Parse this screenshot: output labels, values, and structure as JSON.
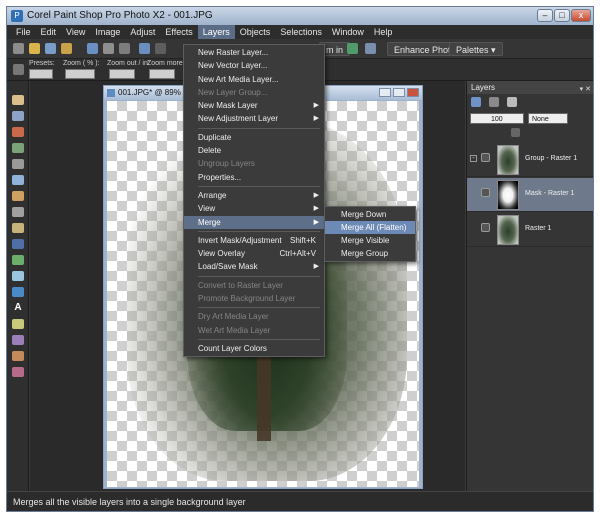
{
  "window": {
    "title": "Corel Paint Shop Pro Photo X2 - 001.JPG",
    "min": "–",
    "max": "□",
    "close": "x"
  },
  "menubar": [
    {
      "label": "File"
    },
    {
      "label": "Edit"
    },
    {
      "label": "View"
    },
    {
      "label": "Image"
    },
    {
      "label": "Adjust"
    },
    {
      "label": "Effects"
    },
    {
      "label": "Layers"
    },
    {
      "label": "Objects"
    },
    {
      "label": "Selections"
    },
    {
      "label": "Window"
    },
    {
      "label": "Help"
    }
  ],
  "toolbar": {
    "zoom_in": "m in",
    "enhance_photo": "Enhance Photo ▾",
    "palettes": "Palettes ▾"
  },
  "tool_options": {
    "presets": "Presets:",
    "zoom_pct": "Zoom ( % ):",
    "zoom_out_in": "Zoom out / in:",
    "zoom_more": "Zoom more:"
  },
  "image_window": {
    "title": "001.JPG* @  89%"
  },
  "layers_menu": [
    {
      "label": "New Raster Layer...",
      "state": "normal"
    },
    {
      "label": "New Vector Layer...",
      "state": "normal"
    },
    {
      "label": "New Art Media Layer...",
      "state": "normal"
    },
    {
      "label": "New Layer Group...",
      "state": "disabled"
    },
    {
      "label": "New Mask Layer",
      "state": "normal",
      "submenu": true
    },
    {
      "label": "New Adjustment Layer",
      "state": "normal",
      "submenu": true
    },
    {
      "sep": true
    },
    {
      "label": "Duplicate",
      "state": "normal"
    },
    {
      "label": "Delete",
      "state": "normal"
    },
    {
      "label": "Ungroup Layers",
      "state": "disabled"
    },
    {
      "label": "Properties...",
      "state": "normal"
    },
    {
      "sep": true
    },
    {
      "label": "Arrange",
      "state": "normal",
      "submenu": true
    },
    {
      "label": "View",
      "state": "normal",
      "submenu": true
    },
    {
      "label": "Merge",
      "state": "highlight",
      "submenu": true
    },
    {
      "sep": true
    },
    {
      "label": "Invert Mask/Adjustment",
      "state": "normal",
      "shortcut": "Shift+K"
    },
    {
      "label": "View Overlay",
      "state": "normal",
      "shortcut": "Ctrl+Alt+V"
    },
    {
      "label": "Load/Save Mask",
      "state": "normal",
      "submenu": true
    },
    {
      "sep": true
    },
    {
      "label": "Convert to Raster Layer",
      "state": "disabled"
    },
    {
      "label": "Promote Background Layer",
      "state": "disabled"
    },
    {
      "sep": true
    },
    {
      "label": "Dry Art Media Layer",
      "state": "disabled"
    },
    {
      "label": "Wet Art Media Layer",
      "state": "disabled"
    },
    {
      "sep": true
    },
    {
      "label": "Count Layer Colors",
      "state": "normal"
    }
  ],
  "merge_submenu": [
    {
      "label": "Merge Down",
      "state": "normal"
    },
    {
      "label": "Merge All (Flatten)",
      "state": "highlight"
    },
    {
      "label": "Merge Visible",
      "state": "normal"
    },
    {
      "label": "Merge Group",
      "state": "normal"
    }
  ],
  "layers_palette": {
    "title": "Layers",
    "title_buttons": "▾ ✕",
    "opacity": "100",
    "blend": "None",
    "rows": [
      {
        "name": "Group - Raster 1",
        "thumb": "tree",
        "selected": false
      },
      {
        "name": "Mask - Raster 1",
        "thumb": "mask",
        "selected": true
      },
      {
        "name": "Raster 1",
        "thumb": "tree",
        "selected": false
      }
    ]
  },
  "statusbar": {
    "text": "Merges all the visible layers into a single background layer"
  },
  "colors": {
    "accent": "#5d6f89",
    "highlight": "#6d89b5",
    "menu_bg": "#3b3b3b"
  }
}
